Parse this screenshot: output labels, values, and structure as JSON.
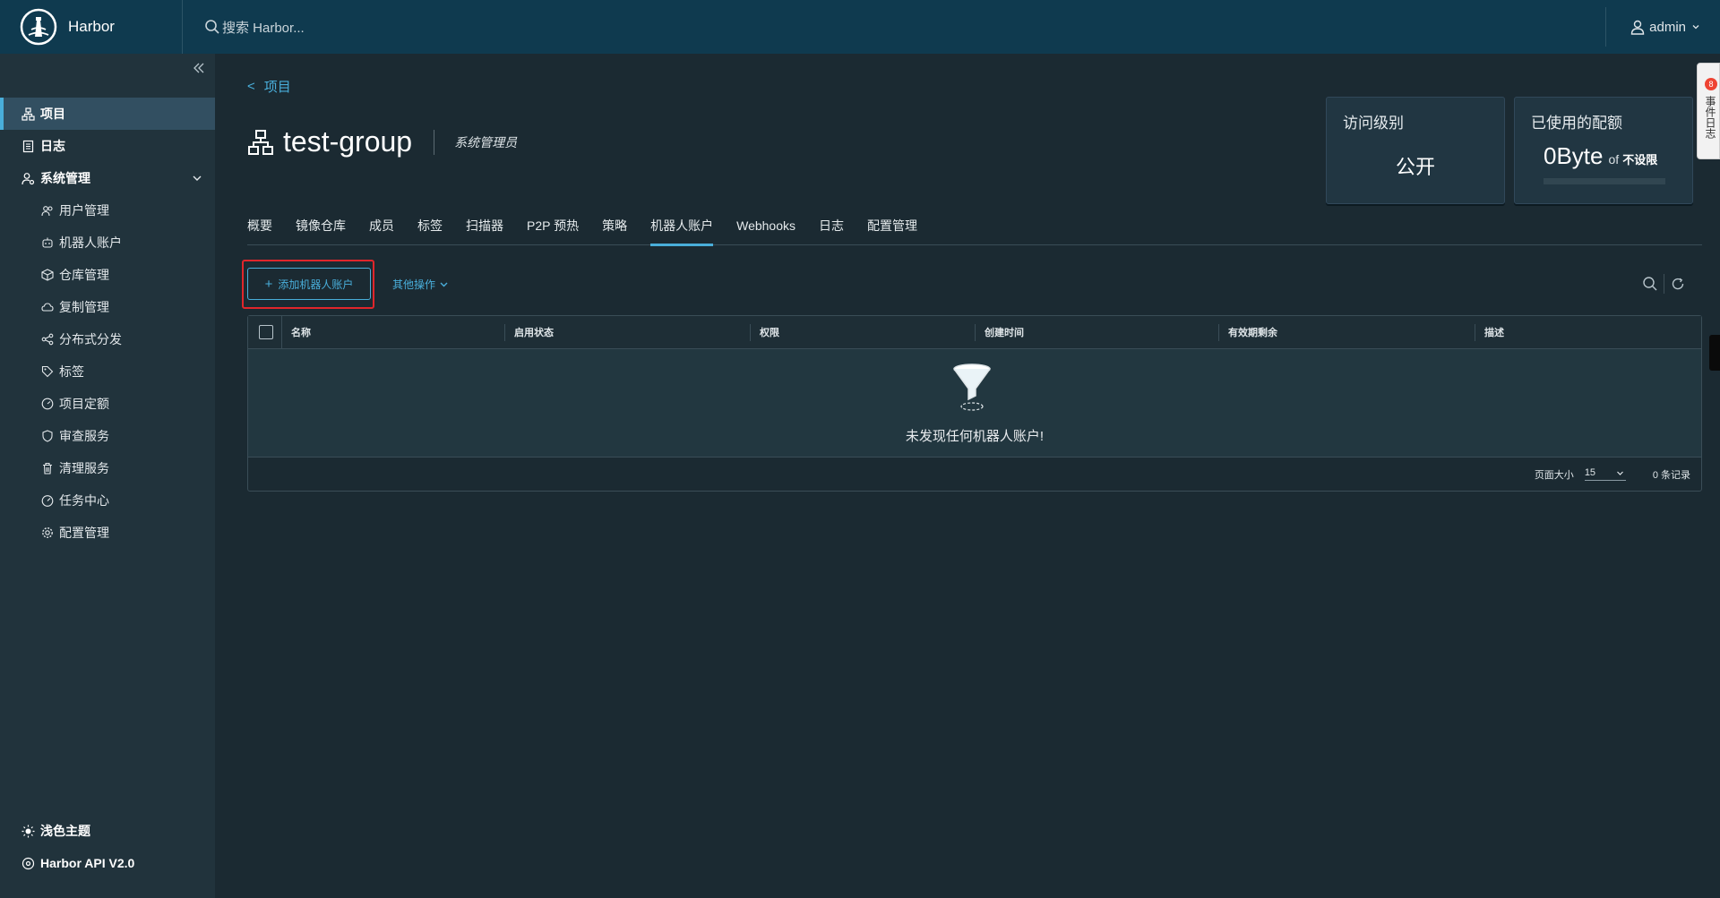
{
  "header": {
    "brand": "Harbor",
    "search_placeholder": "搜索 Harbor...",
    "user": "admin"
  },
  "sidebar": {
    "items": [
      {
        "label": "项目",
        "icon": "projects-icon",
        "active": true
      },
      {
        "label": "日志",
        "icon": "logs-icon"
      },
      {
        "label": "系统管理",
        "icon": "admin-icon",
        "expanded": true
      }
    ],
    "sub_items": [
      {
        "label": "用户管理",
        "icon": "users-icon"
      },
      {
        "label": "机器人账户",
        "icon": "robot-icon"
      },
      {
        "label": "仓库管理",
        "icon": "registry-icon"
      },
      {
        "label": "复制管理",
        "icon": "replication-icon"
      },
      {
        "label": "分布式分发",
        "icon": "distribution-icon"
      },
      {
        "label": "标签",
        "icon": "tag-icon"
      },
      {
        "label": "项目定额",
        "icon": "quota-icon"
      },
      {
        "label": "审查服务",
        "icon": "shield-icon"
      },
      {
        "label": "清理服务",
        "icon": "trash-icon"
      },
      {
        "label": "任务中心",
        "icon": "dashboard-icon"
      },
      {
        "label": "配置管理",
        "icon": "gear-icon"
      }
    ],
    "bottom": [
      {
        "label": "浅色主题",
        "icon": "sun-icon"
      },
      {
        "label": "Harbor API V2.0",
        "icon": "api-icon"
      }
    ]
  },
  "main": {
    "breadcrumb": "项目",
    "project_name": "test-group",
    "role": "系统管理员",
    "access_card": {
      "title": "访问级别",
      "value": "公开"
    },
    "quota_card": {
      "title": "已使用的配额",
      "value": "0Byte",
      "of": "of",
      "limit": "不设限",
      "used_fraction": 0
    },
    "tabs": [
      "概要",
      "镜像仓库",
      "成员",
      "标签",
      "扫描器",
      "P2P 预热",
      "策略",
      "机器人账户",
      "Webhooks",
      "日志",
      "配置管理"
    ],
    "active_tab": "机器人账户",
    "add_button": "添加机器人账户",
    "more_button": "其他操作",
    "columns": [
      "名称",
      "启用状态",
      "权限",
      "创建时间",
      "有效期剩余",
      "描述"
    ],
    "empty_text": "未发现任何机器人账户!",
    "page_size_label": "页面大小",
    "page_size": "15",
    "record_count": "0 条记录"
  },
  "right_panel": {
    "badge": "8",
    "label": "事件日志"
  },
  "colors": {
    "header_bg": "#0f3a4f",
    "sidebar_bg": "#21333c",
    "content_bg": "#1b2a32",
    "accent": "#49aeda",
    "highlight_box": "#e0262b"
  }
}
